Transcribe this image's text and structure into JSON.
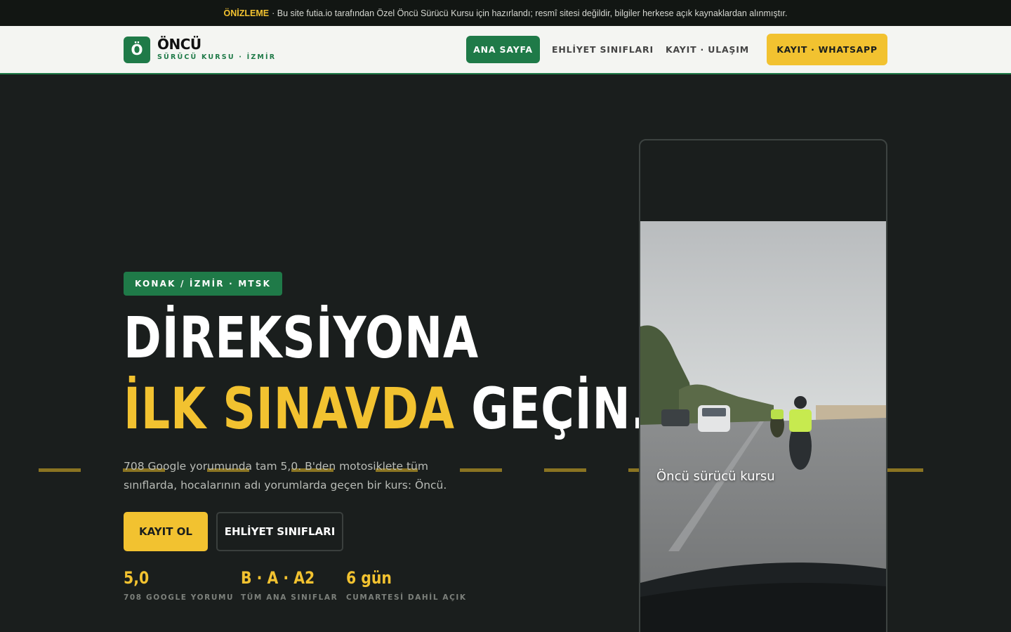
{
  "preview_bar": {
    "tag": "ÖNİZLEME",
    "text": "· Bu site futia.io tarafından Özel Öncü Sürücü Kursu için hazırlandı; resmî sitesi değildir, bilgiler herkese açık kaynaklardan alınmıştır."
  },
  "nav": {
    "logo_letter": "Ö",
    "brand_name": "ÖNCÜ",
    "brand_sub": "SÜRÜCÜ KURSU · İZMİR",
    "links": [
      "ANA SAYFA",
      "EHLİYET SINIFLARI",
      "KAYIT · ULAŞIM"
    ],
    "cta": "KAYIT · WHATSAPP"
  },
  "hero": {
    "badge": "KONAK / İZMİR · MTSK",
    "line1": "DİREKSİYONA",
    "line2_highlight": "İLK SINAVDA",
    "line2_rest": "GEÇİN.",
    "description": "708 Google yorumunda tam 5,0. B'den motosiklete tüm sınıflarda, hocalarının adı yorumlarda geçen bir kurs: Öncü.",
    "primary_button": "KAYIT OL",
    "secondary_button": "EHLİYET SINIFLARI",
    "stats": [
      {
        "value": "5,0",
        "label": "708 GOOGLE YORUMU"
      },
      {
        "value": "B · A · A2",
        "label": "TÜM ANA SINIFLAR"
      },
      {
        "value": "6 gün",
        "label": "CUMARTESİ DAHİL AÇIK"
      }
    ]
  },
  "video": {
    "caption": "Öncü sürücü kursu"
  },
  "colors": {
    "accent_green": "#1f7a48",
    "accent_yellow": "#f2c230",
    "background": "#1a1e1d"
  }
}
